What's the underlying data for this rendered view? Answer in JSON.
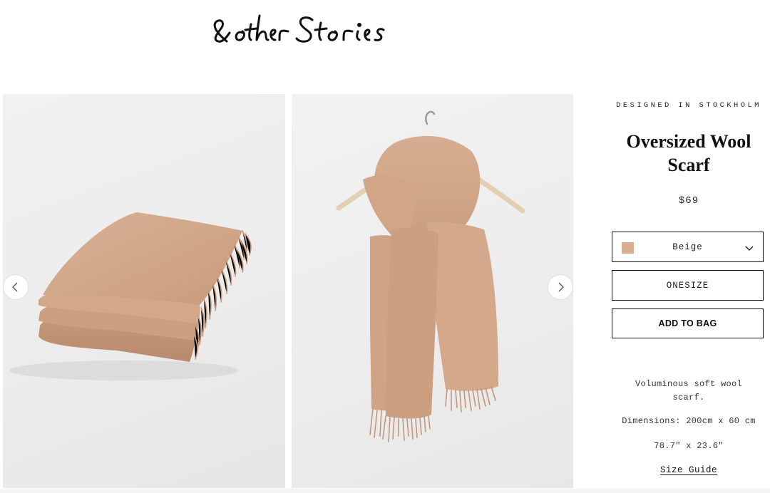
{
  "brand": {
    "logo_text": "& other Stories",
    "logo_icon": "brand-logo"
  },
  "gallery": {
    "prev_icon": "chevron-left-icon",
    "next_icon": "chevron-right-icon",
    "image_color": "#d2a88a"
  },
  "product": {
    "eyebrow": "DESIGNED IN STOCKHOLM",
    "title_line1": "Oversized Wool",
    "title_line2": "Scarf",
    "price": "$69",
    "color_select": {
      "value": "Beige",
      "swatch_color": "#d8ac90",
      "icon": "chevron-down-icon"
    },
    "size_select": {
      "value": "ONESIZE"
    },
    "add_to_bag_label": "ADD TO BAG",
    "description_line1": "Voluminous soft wool",
    "description_line2": "scarf.",
    "dimensions_line1": "Dimensions: 200cm x 60 cm",
    "dimensions_line2": "78.7\" x 23.6\"",
    "size_guide_label": "Size Guide"
  }
}
